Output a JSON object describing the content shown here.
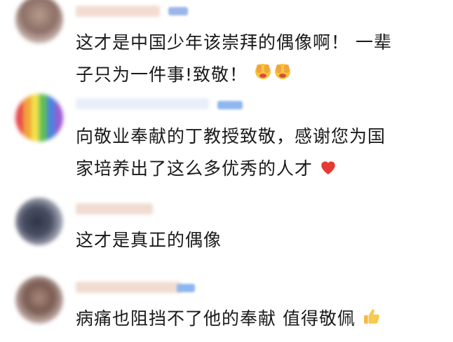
{
  "comments": [
    {
      "line1": "这才是中国少年该崇拜的偶像啊！ 一辈",
      "line2": "子只为一件事!致敬！",
      "emoji": "salute-face-icon"
    },
    {
      "line1": "向敬业奉献的丁教授致敬，感谢您为国",
      "line2": "家培养出了这么多优秀的人才",
      "emoji": "red-heart-icon"
    },
    {
      "line1": "这才是真正的偶像"
    },
    {
      "line1": "病痛也阻挡不了他的奉献 值得敬佩",
      "emoji": "thumbs-up-icon"
    }
  ]
}
